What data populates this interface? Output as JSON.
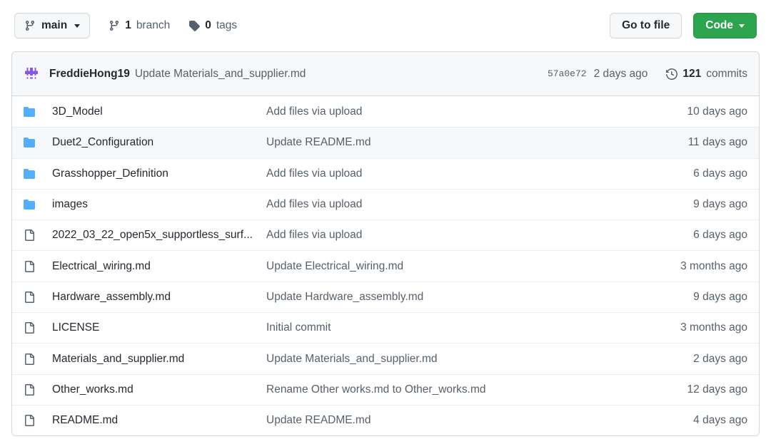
{
  "toolbar": {
    "branch_button": {
      "label": "main",
      "icon": "git-branch-icon",
      "caret": "chevron-down-icon"
    },
    "branches": {
      "count": "1",
      "label": "branch",
      "icon": "git-branch-icon"
    },
    "tags": {
      "count": "0",
      "label": "tags",
      "icon": "tag-icon"
    },
    "go_to_file_label": "Go to file",
    "code_label": "Code"
  },
  "commit_header": {
    "avatar": "user-avatar-identicon",
    "author": "FreddieHong19",
    "message": "Update Materials_and_supplier.md",
    "sha": "57a0e72",
    "time": "2 days ago",
    "commits_count": "121",
    "commits_label": "commits",
    "commits_icon": "history-icon"
  },
  "colors": {
    "accent_green": "#2da44e",
    "folder_blue": "#54aeff",
    "text_primary": "#24292f",
    "text_muted": "#57606a",
    "border": "#d0d7de",
    "header_bg": "#f6f8fa",
    "avatar_purple": "#8957e5"
  },
  "files": [
    {
      "type": "folder",
      "name": "3D_Model",
      "message": "Add files via upload",
      "time": "10 days ago"
    },
    {
      "type": "folder",
      "name": "Duet2_Configuration",
      "message": "Update README.md",
      "time": "11 days ago"
    },
    {
      "type": "folder",
      "name": "Grasshopper_Definition",
      "message": "Add files via upload",
      "time": "6 days ago"
    },
    {
      "type": "folder",
      "name": "images",
      "message": "Add files via upload",
      "time": "9 days ago"
    },
    {
      "type": "file",
      "name": "2022_03_22_open5x_supportless_surf...",
      "message": "Add files via upload",
      "time": "6 days ago"
    },
    {
      "type": "file",
      "name": "Electrical_wiring.md",
      "message": "Update Electrical_wiring.md",
      "time": "3 months ago"
    },
    {
      "type": "file",
      "name": "Hardware_assembly.md",
      "message": "Update Hardware_assembly.md",
      "time": "9 days ago"
    },
    {
      "type": "file",
      "name": "LICENSE",
      "message": "Initial commit",
      "time": "3 months ago"
    },
    {
      "type": "file",
      "name": "Materials_and_supplier.md",
      "message": "Update Materials_and_supplier.md",
      "time": "2 days ago"
    },
    {
      "type": "file",
      "name": "Other_works.md",
      "message": "Rename Other works.md to Other_works.md",
      "time": "12 days ago"
    },
    {
      "type": "file",
      "name": "README.md",
      "message": "Update README.md",
      "time": "4 days ago"
    }
  ]
}
